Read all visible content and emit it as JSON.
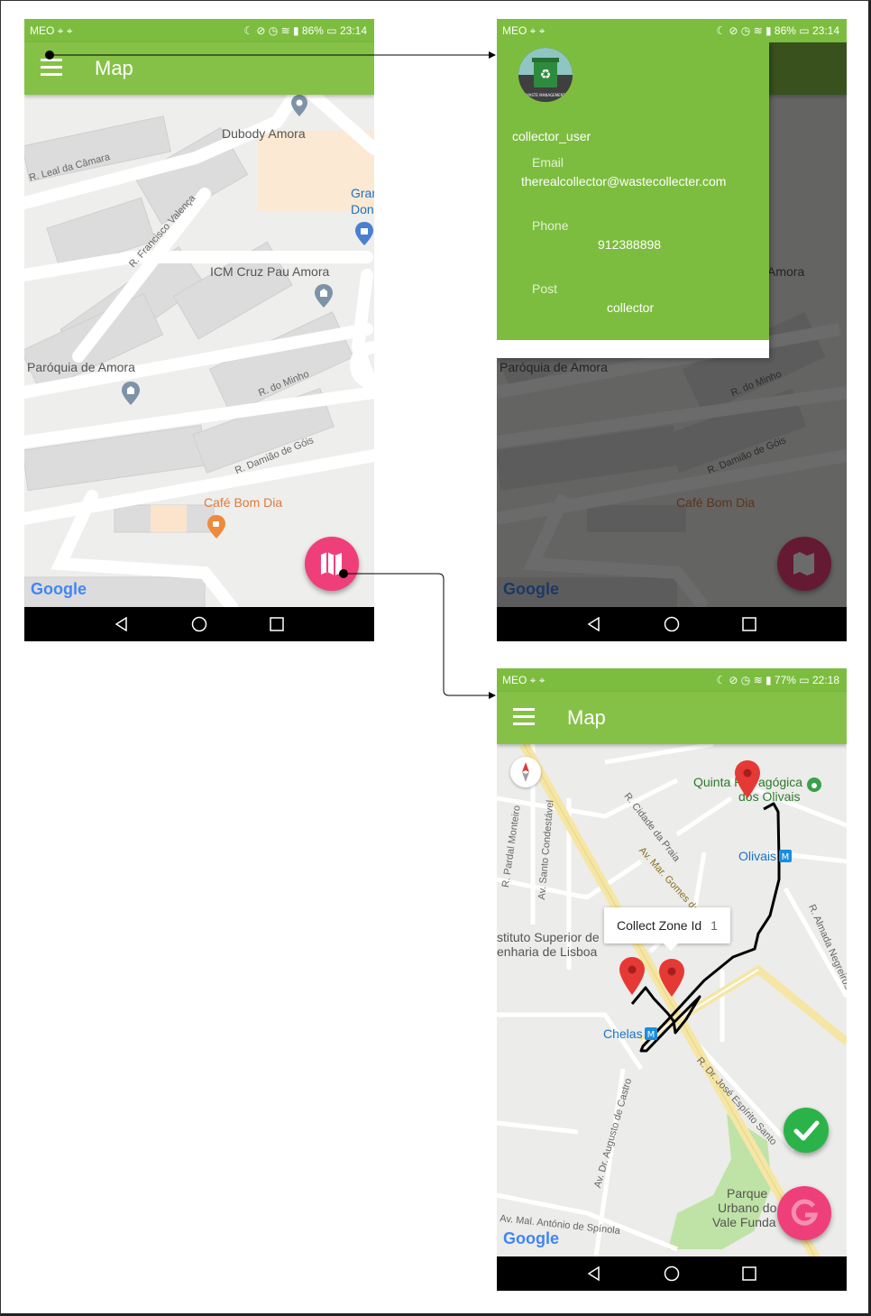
{
  "status_top": {
    "carrier": "MEO",
    "battery": "86%",
    "time": "23:14"
  },
  "status_bottom": {
    "carrier": "MEO",
    "battery": "77%",
    "time": "22:18"
  },
  "appbar": {
    "title": "Map"
  },
  "map1": {
    "places": [
      "Dubody Amora",
      "ICM Cruz Pau Amora",
      "Paróquia de Amora",
      "Café Bom Dia",
      "Gran",
      "Don"
    ],
    "streets": [
      "R. Leal da Câmara",
      "R. Francisco Valença",
      "R. do Minho",
      "R. Damião de Góis"
    ],
    "attribution": "Google"
  },
  "drawer": {
    "username": "collector_user",
    "email_label": "Email",
    "email": "therealcollector@wastecollecter.com",
    "phone_label": "Phone",
    "phone": "912388898",
    "post_label": "Post",
    "post": "collector",
    "avatar_caption": "WASTE MANAGEMENT"
  },
  "map3": {
    "places": [
      "Quinta Pedagógica dos Olivais",
      "Olivais",
      "Chelas",
      "Instituto Superior de Engenharia de Lisboa",
      "Parque Urbano do Vale Fundão"
    ],
    "place_lines": {
      "quinta1": "Quinta P",
      "quinta2": "agógica",
      "quinta3": "dos Olivais",
      "isel1": "stituto Superior de",
      "isel2": "enharia de Lisboa",
      "parque1": "Parque",
      "parque2": "Urbano do",
      "parque3": "Vale Funda"
    },
    "streets": [
      "R. Cidade da Praia",
      "Av. Mar. Gomes da",
      "R. Pardal Monteiro",
      "Av. Santo Condestável",
      "R. Almada Negreiros",
      "R. Dr. José Espírito Santo",
      "Av. Dr. Augusto de Castro",
      "Av. Mal. António de Spínola"
    ],
    "info_window": {
      "label": "Collect Zone Id",
      "value": "1"
    },
    "attribution": "Google"
  },
  "icons": {
    "menu": "hamburger-menu-icon",
    "fab_map": "map-icon",
    "fab_check": "check-icon",
    "fab_g": "g-icon",
    "compass": "compass-icon",
    "marker": "map-marker-icon"
  },
  "colors": {
    "appbar": "#85c146",
    "statusbar": "#7cbd3f",
    "fab": "#ef3f7b",
    "check": "#2bb34a",
    "marker": "#e53935",
    "route": "#000000"
  }
}
